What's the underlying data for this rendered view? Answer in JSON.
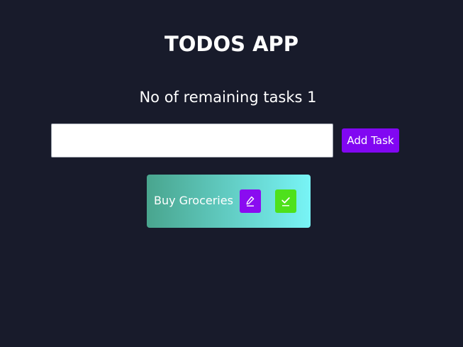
{
  "header": {
    "title": "TODOS APP"
  },
  "status": {
    "remaining_text": "No of remaining tasks 1"
  },
  "form": {
    "input_value": "",
    "input_placeholder": "",
    "add_label": "Add Task"
  },
  "todos": [
    {
      "text": "Buy Groceries",
      "edit_icon": "pencil-icon",
      "done_icon": "check-icon"
    }
  ],
  "colors": {
    "background": "#181b2b",
    "add_button": "#8107f2",
    "edit_button": "#8a0cf0",
    "done_button": "#4ee11c",
    "card_gradient_start": "#49a58e",
    "card_gradient_end": "#78f4f6"
  }
}
